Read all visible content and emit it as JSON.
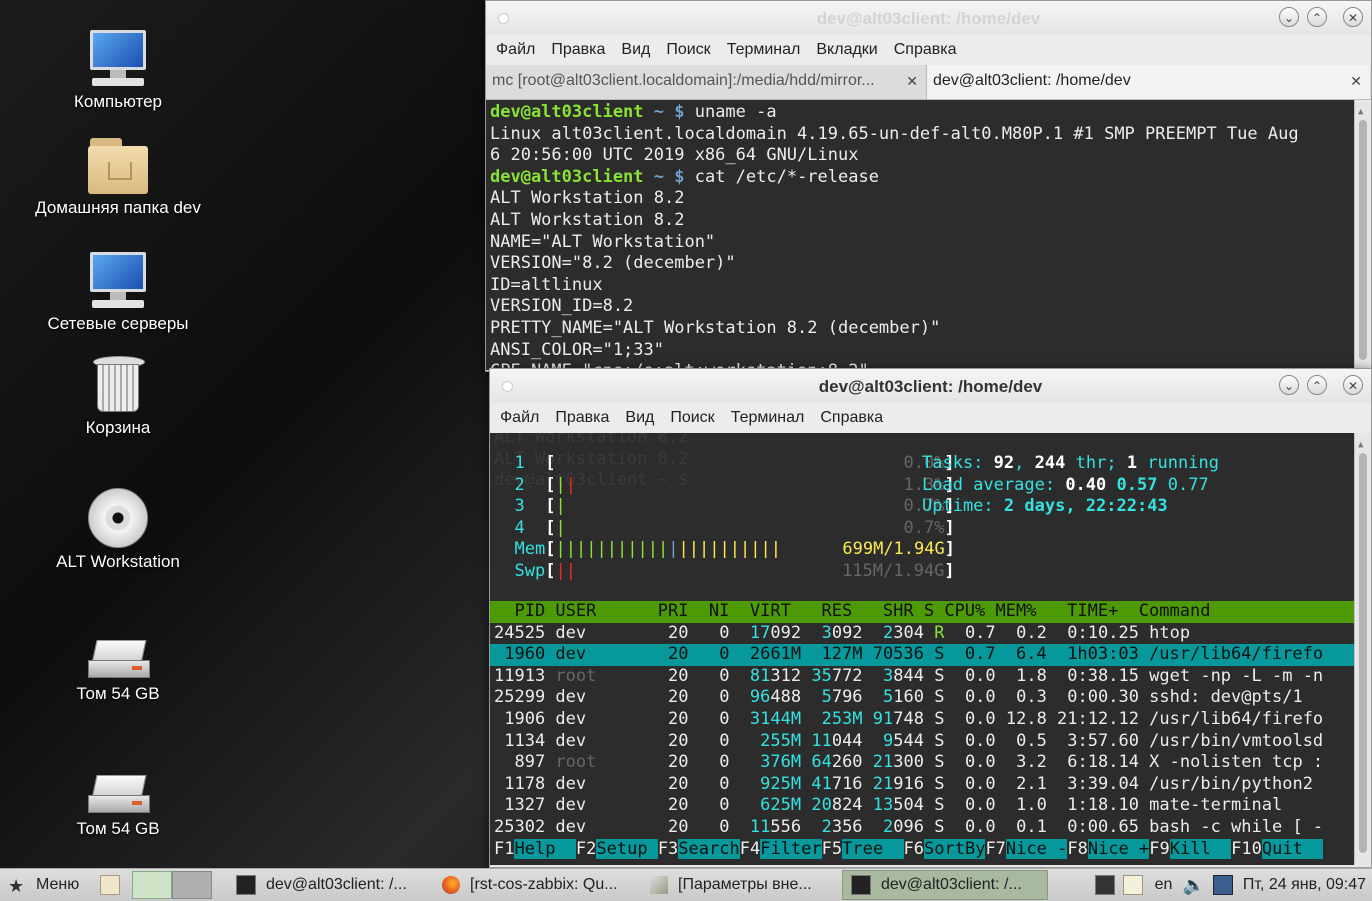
{
  "desktop": {
    "icons": [
      {
        "label": "Компьютер"
      },
      {
        "label": "Домашняя папка dev"
      },
      {
        "label": "Сетевые серверы"
      },
      {
        "label": "Корзина"
      },
      {
        "label": "ALT Workstation"
      },
      {
        "label": "Том 54 GB"
      },
      {
        "label": "Том 54 GB"
      }
    ]
  },
  "terminal1": {
    "title": "dev@alt03client: /home/dev",
    "menu": [
      "Файл",
      "Правка",
      "Вид",
      "Поиск",
      "Терминал",
      "Вкладки",
      "Справка"
    ],
    "tabs": [
      {
        "label": "mc [root@alt03client.localdomain]:/media/hdd/mirror..."
      },
      {
        "label": "dev@alt03client: /home/dev"
      }
    ],
    "prompt_user": "dev@alt03client",
    "prompt_path": " ~ $",
    "cmd1": " uname -a",
    "cmd2": " cat /etc/*-release",
    "output1": [
      "Linux alt03client.localdomain 4.19.65-un-def-alt0.M80P.1 #1 SMP PREEMPT Tue Aug",
      "6 20:56:00 UTC 2019 x86_64 GNU/Linux"
    ],
    "output2": [
      "ALT Workstation 8.2",
      "ALT Workstation 8.2",
      "NAME=\"ALT Workstation\"",
      "VERSION=\"8.2 (december)\"",
      "ID=altlinux",
      "VERSION_ID=8.2",
      "PRETTY_NAME=\"ALT Workstation 8.2 (december)\"",
      "ANSI_COLOR=\"1;33\"",
      "CPE_NAME=\"cpe:/o:alt:workstation:8.2\""
    ]
  },
  "terminal2": {
    "title": "dev@alt03client: /home/dev",
    "menu": [
      "Файл",
      "Правка",
      "Вид",
      "Поиск",
      "Терминал",
      "Справка"
    ],
    "ghost": [
      "ALT Workstation 8.2",
      "ALT Workstation 8.2",
      "dev@alt03client ~ $"
    ],
    "cpus": [
      {
        "n": "1",
        "bars": "",
        "pct": "0.0%"
      },
      {
        "n": "2",
        "bars": "||",
        "pct": "1.3%"
      },
      {
        "n": "3",
        "bars": "|",
        "pct": "0.7%"
      },
      {
        "n": "4",
        "bars": "|",
        "pct": "0.7%"
      }
    ],
    "mem": {
      "label": "Mem",
      "bars": "||||||||||||||||||||||",
      "value": "699M/1.94G"
    },
    "swp": {
      "label": "Swp",
      "bars": "||",
      "value": "115M/1.94G"
    },
    "tasks": {
      "label": "Tasks:",
      "count": "92",
      "thr": "244",
      "thr_label": "thr;",
      "running": "1",
      "running_label": "running"
    },
    "load": {
      "label": "Load average:",
      "v1": "0.40",
      "v2": "0.57",
      "v3": "0.77"
    },
    "uptime": {
      "label": "Uptime:",
      "value": "2 days, 22:22:43"
    },
    "header": "  PID USER      PRI  NI  VIRT   RES   SHR S CPU% MEM%   TIME+  Command",
    "processes": [
      {
        "pid": "24525",
        "user": "dev",
        "pri": "20",
        "ni": "0",
        "virt": "17092",
        "res": "3092",
        "shr": "2304",
        "s": "R",
        "cpu": "0.7",
        "mem": "0.2",
        "time": "0:10.25",
        "cmd": "htop"
      },
      {
        "pid": "1960",
        "user": "dev",
        "pri": "20",
        "ni": "0",
        "virt": "2661M",
        "res": "127M",
        "shr": "70536",
        "s": "S",
        "cpu": "0.7",
        "mem": "6.4",
        "time": "1h03:03",
        "cmd": "/usr/lib64/firefo"
      },
      {
        "pid": "11913",
        "user": "root",
        "pri": "20",
        "ni": "0",
        "virt": "81312",
        "res": "35772",
        "shr": "3844",
        "s": "S",
        "cpu": "0.0",
        "mem": "1.8",
        "time": "0:38.15",
        "cmd": "wget -np -L -m -n"
      },
      {
        "pid": "25299",
        "user": "dev",
        "pri": "20",
        "ni": "0",
        "virt": "96488",
        "res": "5796",
        "shr": "5160",
        "s": "S",
        "cpu": "0.0",
        "mem": "0.3",
        "time": "0:00.30",
        "cmd": "sshd: dev@pts/1"
      },
      {
        "pid": "1906",
        "user": "dev",
        "pri": "20",
        "ni": "0",
        "virt": "3144M",
        "res": "253M",
        "shr": "91748",
        "s": "S",
        "cpu": "0.0",
        "mem": "12.8",
        "time": "21:12.12",
        "cmd": "/usr/lib64/firefo"
      },
      {
        "pid": "1134",
        "user": "dev",
        "pri": "20",
        "ni": "0",
        "virt": "255M",
        "res": "11044",
        "shr": "9544",
        "s": "S",
        "cpu": "0.0",
        "mem": "0.5",
        "time": "3:57.60",
        "cmd": "/usr/bin/vmtoolsd"
      },
      {
        "pid": "897",
        "user": "root",
        "pri": "20",
        "ni": "0",
        "virt": "376M",
        "res": "64260",
        "shr": "21300",
        "s": "S",
        "cpu": "0.0",
        "mem": "3.2",
        "time": "6:18.14",
        "cmd": "X -nolisten tcp :"
      },
      {
        "pid": "1178",
        "user": "dev",
        "pri": "20",
        "ni": "0",
        "virt": "925M",
        "res": "41716",
        "shr": "21916",
        "s": "S",
        "cpu": "0.0",
        "mem": "2.1",
        "time": "3:39.04",
        "cmd": "/usr/bin/python2"
      },
      {
        "pid": "1327",
        "user": "dev",
        "pri": "20",
        "ni": "0",
        "virt": "625M",
        "res": "20824",
        "shr": "13504",
        "s": "S",
        "cpu": "0.0",
        "mem": "1.0",
        "time": "1:18.10",
        "cmd": "mate-terminal"
      },
      {
        "pid": "25302",
        "user": "dev",
        "pri": "20",
        "ni": "0",
        "virt": "11556",
        "res": "2356",
        "shr": "2096",
        "s": "S",
        "cpu": "0.0",
        "mem": "0.1",
        "time": "0:00.65",
        "cmd": "bash -c while [ -"
      }
    ],
    "fkeys": [
      {
        "key": "F1",
        "label": "Help  "
      },
      {
        "key": "F2",
        "label": "Setup "
      },
      {
        "key": "F3",
        "label": "Search"
      },
      {
        "key": "F4",
        "label": "Filter"
      },
      {
        "key": "F5",
        "label": "Tree  "
      },
      {
        "key": "F6",
        "label": "SortBy"
      },
      {
        "key": "F7",
        "label": "Nice -"
      },
      {
        "key": "F8",
        "label": "Nice +"
      },
      {
        "key": "F9",
        "label": "Kill  "
      },
      {
        "key": "F10",
        "label": "Quit  "
      }
    ]
  },
  "taskbar": {
    "menu_label": "Меню",
    "items": [
      {
        "label": "dev@alt03client: /..."
      },
      {
        "label": "[rst-cos-zabbix: Qu..."
      },
      {
        "label": "[Параметры вне..."
      },
      {
        "label": "dev@alt03client: /..."
      }
    ],
    "lang": "en",
    "clock": "Пт, 24 янв, 09:47"
  }
}
